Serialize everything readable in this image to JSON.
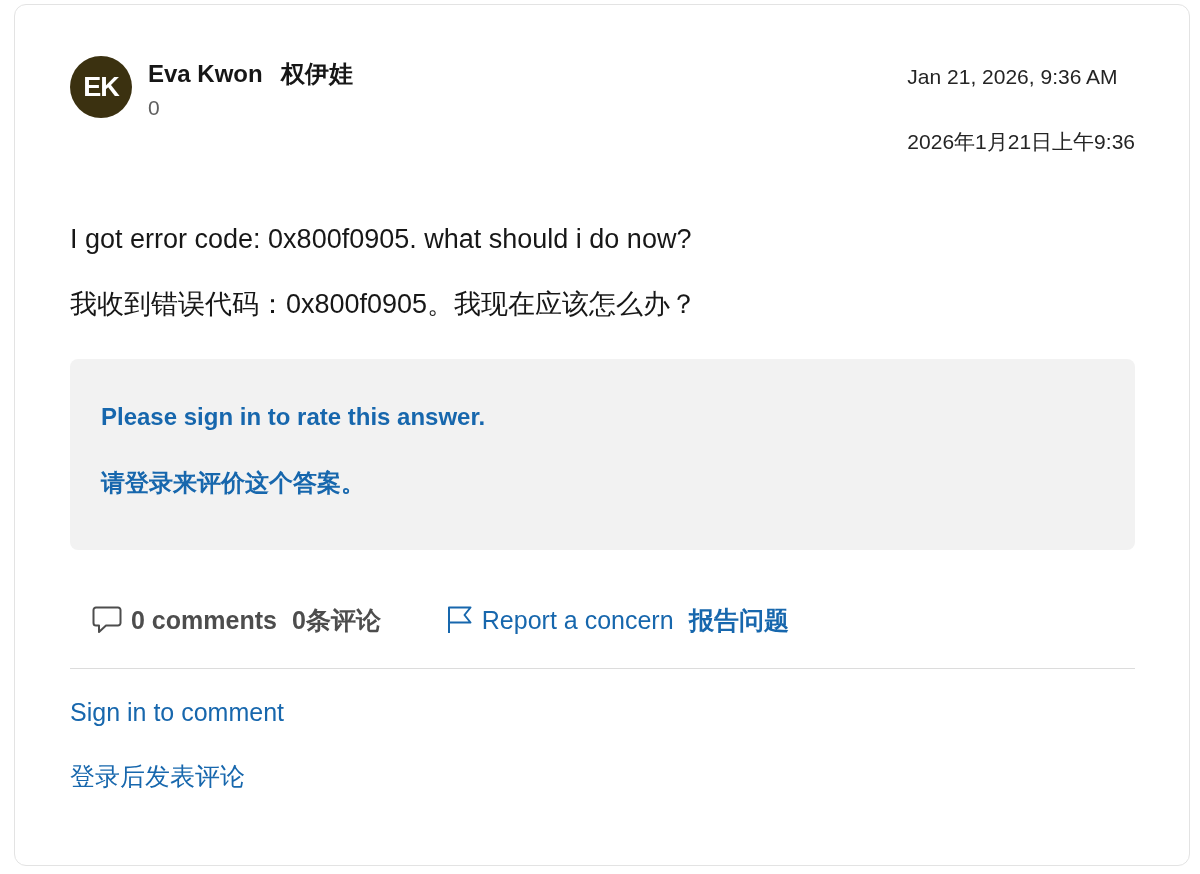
{
  "post": {
    "author": {
      "initials": "EK",
      "name": "Eva Kwon",
      "name_zh": "权伊娃",
      "reputation": "0"
    },
    "timestamps": [
      "Jan 21, 2026, 9:36 AM",
      "2026年1月21日上午9:36"
    ],
    "body": [
      "I got error code: 0x800f0905. what should i do now?",
      "我收到错误代码：0x800f0905。我现在应该怎么办？"
    ],
    "rating_prompt": [
      "Please sign in to rate this answer.",
      "请登录来评价这个答案。"
    ],
    "actions": [
      {
        "kind": "comments",
        "label": "0 comments",
        "label_zh": "0条评论"
      },
      {
        "kind": "report",
        "label": "Report a concern",
        "label_zh": "报告问题"
      }
    ],
    "comment_links": [
      "Sign in to comment",
      "登录后发表评论"
    ]
  }
}
